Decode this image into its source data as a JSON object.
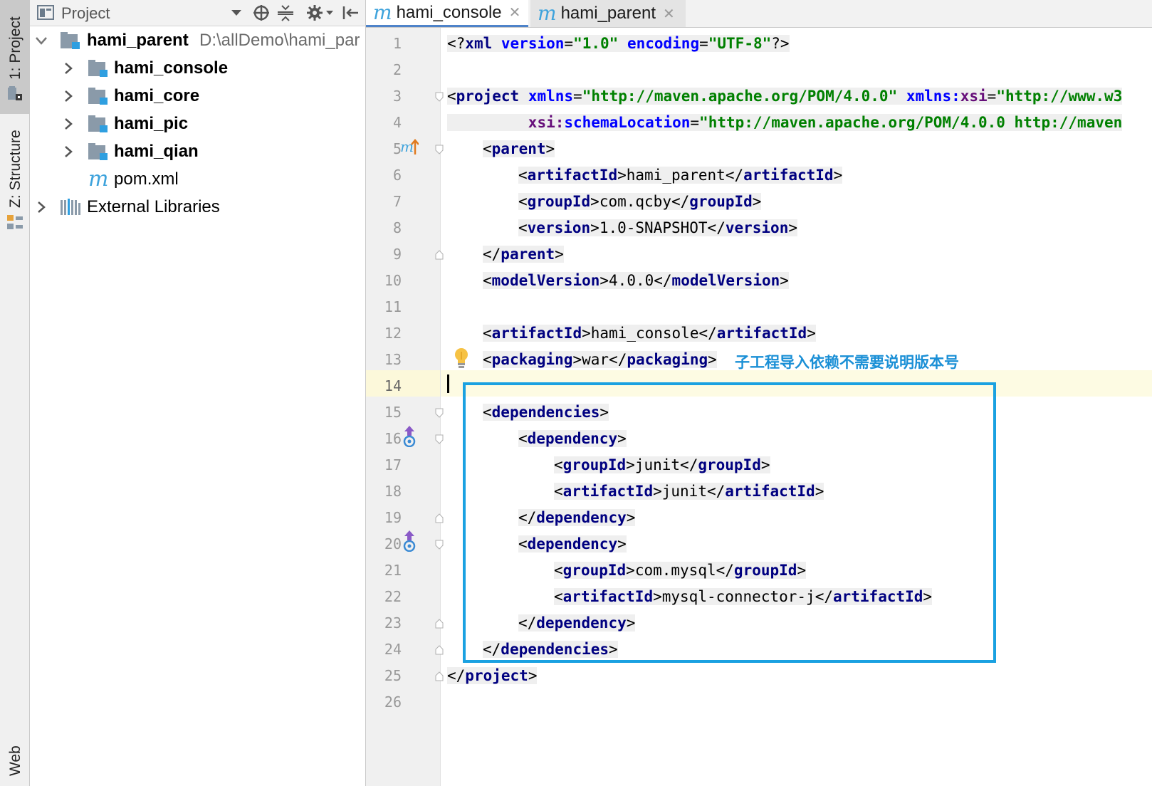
{
  "side_tabs": [
    {
      "label": "1: Project",
      "selected": true
    },
    {
      "label": "Z: Structure",
      "selected": false
    },
    {
      "label": "Web",
      "selected": false
    }
  ],
  "project_panel": {
    "title": "Project",
    "header_icons": [
      "dropdown-arrow-icon",
      "locate-icon",
      "collapse-all-icon",
      "settings-icon",
      "hide-panel-icon"
    ],
    "tree": [
      {
        "label": "hami_parent",
        "path": "D:\\allDemo\\hami_par",
        "expanded": true,
        "icon": "module-folder-icon",
        "bold": true
      },
      {
        "label": "hami_console",
        "expanded": false,
        "icon": "module-folder-icon",
        "bold": true
      },
      {
        "label": "hami_core",
        "expanded": false,
        "icon": "module-folder-icon",
        "bold": true
      },
      {
        "label": "hami_pic",
        "expanded": false,
        "icon": "module-folder-icon",
        "bold": true
      },
      {
        "label": "hami_qian",
        "expanded": false,
        "icon": "module-folder-icon",
        "bold": true
      },
      {
        "label": "pom.xml",
        "icon": "maven-file-icon",
        "bold": false
      },
      {
        "label": "External Libraries",
        "expanded": false,
        "icon": "libraries-icon",
        "bold": false
      }
    ]
  },
  "editor": {
    "tabs": [
      {
        "label": "hami_console",
        "active": true
      },
      {
        "label": "hami_parent",
        "active": false
      }
    ],
    "current_line": 14,
    "line_numbers": [
      "1",
      "2",
      "3",
      "4",
      "5",
      "6",
      "7",
      "8",
      "9",
      "10",
      "11",
      "12",
      "13",
      "14",
      "15",
      "16",
      "17",
      "18",
      "19",
      "20",
      "21",
      "22",
      "23",
      "24",
      "25",
      "26"
    ],
    "code": {
      "l1": {
        "open": "<?",
        "name": "xml",
        "a1": "version",
        "eq1": "=",
        "v1": "\"1.0\"",
        "a2": "encoding",
        "eq2": "=",
        "v2": "\"UTF-8\"",
        "close": "?>"
      },
      "l3": {
        "open": "<",
        "name": "project",
        "a1": "xmlns",
        "eq1": "=",
        "v1": "\"http://maven.apache.org/POM/4.0.0\"",
        "a2ns": "xmlns:",
        "a2": "xsi",
        "eq2": "=",
        "v2": "\"http://www.w3"
      },
      "l4": {
        "ns": "xsi:",
        "a": "schemaLocation",
        "eq": "=",
        "v": "\"http://maven.apache.org/POM/4.0.0 http://maven"
      },
      "l5": {
        "name": "parent"
      },
      "l6": {
        "name": "artifactId",
        "text": "hami_parent"
      },
      "l7": {
        "name": "groupId",
        "text": "com.qcby"
      },
      "l8": {
        "name": "version",
        "text": "1.0-SNAPSHOT"
      },
      "l9": {
        "name": "parent"
      },
      "l10": {
        "name": "modelVersion",
        "text": "4.0.0"
      },
      "l12": {
        "name": "artifactId",
        "text": "hami_console"
      },
      "l13": {
        "name": "packaging",
        "text": "war"
      },
      "l15": {
        "name": "dependencies"
      },
      "l16": {
        "name": "dependency"
      },
      "l17": {
        "name": "groupId",
        "text": "junit"
      },
      "l18": {
        "name": "artifactId",
        "text": "junit"
      },
      "l19": {
        "name": "dependency"
      },
      "l20": {
        "name": "dependency"
      },
      "l21": {
        "name": "groupId",
        "text": "com.mysql"
      },
      "l22": {
        "name": "artifactId",
        "text": "mysql-connector-j"
      },
      "l23": {
        "name": "dependency"
      },
      "l24": {
        "name": "dependencies"
      },
      "l25": {
        "name": "project"
      }
    },
    "gutter_icons": {
      "l5": "maven-parent-up-icon",
      "l13": "lightbulb-icon",
      "l16": "maven-dependency-icon",
      "l20": "maven-dependency-icon"
    }
  },
  "annotation": {
    "text": "子工程导入依赖不需要说明版本号",
    "color": "#1a8fd6",
    "box_color": "#1aa1e1"
  }
}
